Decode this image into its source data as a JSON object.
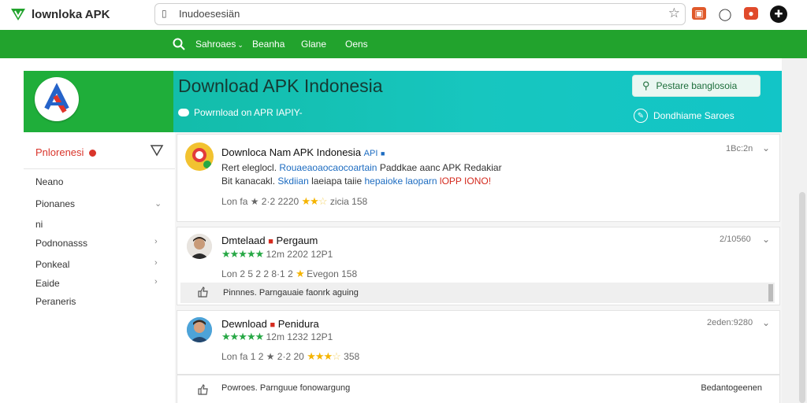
{
  "topbar": {
    "brand": "lownloka APK",
    "address": "Inudoesesiän",
    "colors": {
      "brand_green": "#22a32d",
      "hero_teal": "#12c5c7"
    }
  },
  "nav": {
    "items": [
      {
        "label": "Sahroaes",
        "has_chevron": true
      },
      {
        "label": "Beanha"
      },
      {
        "label": "Glane"
      },
      {
        "label": "Oens"
      }
    ]
  },
  "hero": {
    "title": "Download APK Indonesia",
    "subtitle": "Powrnload on APR IAPIY-",
    "button_label": "Pestare banglosoia",
    "link_label": "Dondhiame Saroes"
  },
  "sidebar": {
    "heading": "Pnlorenesi",
    "items": [
      {
        "label": "Neano"
      },
      {
        "label": "Pionanes",
        "chevron": "⌄"
      },
      {
        "label": "ni"
      },
      {
        "label": "Podnonasss",
        "chevron": "›"
      },
      {
        "label": "Ponkeal",
        "chevron": "›"
      },
      {
        "label": "Eaide",
        "chevron": "›"
      },
      {
        "label": "Peraneris"
      }
    ]
  },
  "cards": [
    {
      "title": "Downloca Nam APK Indonesia",
      "title_tag": "API",
      "time": "1Bc:2n",
      "line1_a": "Rert eleglocl.",
      "line1_b": "Rouaeaoaocaocoartain",
      "line1_c": "Paddkae aanc APK Redakiar",
      "line2_a": "Bit kanacakl.",
      "line2_b": "Skdiian",
      "line2_c": "laeiapa taiie",
      "line2_d": "hepaioke laoparn",
      "line2_e": "lOPP IONO!",
      "meta_a": "Lon fa ★ 2·2 2220",
      "meta_b": "zicia  158",
      "rating": 2.5
    },
    {
      "title": "Dmtelaad",
      "title_b": "Pergaum",
      "time": "2/10560",
      "rating_line": "12m 2202 12P1",
      "meta_a": "Lon 2 5 2 2 8·1 2",
      "meta_b": "Evegon  158",
      "reply_text": "Pinnnes.  Parngauaie faonrk aguing",
      "rating": 5
    },
    {
      "title": "Dewnload",
      "title_b": "Penidura",
      "time": "2eden:9280",
      "rating_line": "12m 1232 12P1",
      "meta_a": "Lon fa 1 2 ★ 2·2 20",
      "meta_b": "358",
      "rating": 3
    }
  ],
  "footer": {
    "reply_text": "Powroes.  Parnguue fonowargung",
    "right_text": "Bedantogeenen"
  }
}
